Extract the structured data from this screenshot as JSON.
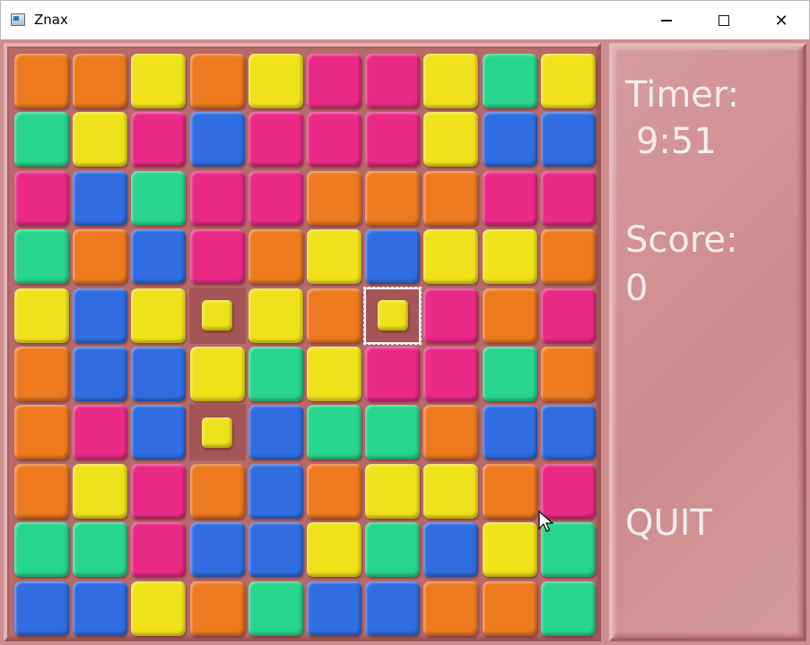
{
  "window": {
    "title": "Znax",
    "icon": "app-window-icon",
    "controls": [
      "minimize-icon",
      "maximize-icon",
      "close-icon"
    ],
    "close_glyph": "✕"
  },
  "colors": {
    "O": "#ee7a20",
    "Y": "#f0e21a",
    "P": "#ea2a86",
    "B": "#2f6de0",
    "G": "#27d58c",
    "frame": "#b86a6a",
    "panel": "#cf8e8e",
    "text": "#fbecec"
  },
  "board": {
    "rows": 10,
    "cols": 10,
    "tiles": [
      [
        "O",
        "O",
        "Y",
        "O",
        "Y",
        "P",
        "P",
        "Y",
        "G",
        "Y"
      ],
      [
        "G",
        "Y",
        "P",
        "B",
        "P",
        "P",
        "P",
        "Y",
        "B",
        "B"
      ],
      [
        "P",
        "B",
        "G",
        "P",
        "P",
        "O",
        "O",
        "O",
        "P",
        "P"
      ],
      [
        "G",
        "O",
        "B",
        "P",
        "O",
        "Y",
        "B",
        "Y",
        "Y",
        "O"
      ],
      [
        "Y",
        "B",
        "Y",
        "y",
        "Y",
        "O",
        "y",
        "P",
        "O",
        "P"
      ],
      [
        "O",
        "B",
        "B",
        "Y",
        "G",
        "Y",
        "P",
        "P",
        "G",
        "O"
      ],
      [
        "O",
        "P",
        "B",
        "y",
        "B",
        "G",
        "G",
        "O",
        "B",
        "B"
      ],
      [
        "O",
        "Y",
        "P",
        "O",
        "B",
        "O",
        "Y",
        "Y",
        "O",
        "P"
      ],
      [
        "G",
        "G",
        "P",
        "B",
        "B",
        "Y",
        "G",
        "B",
        "Y",
        "G"
      ],
      [
        "B",
        "B",
        "Y",
        "O",
        "G",
        "B",
        "B",
        "O",
        "O",
        "G"
      ]
    ],
    "selected": {
      "row": 4,
      "col": 6
    },
    "marked": [
      {
        "row": 4,
        "col": 3
      },
      {
        "row": 6,
        "col": 3
      }
    ]
  },
  "side_panel": {
    "timer_label": "Timer:",
    "timer_value": "9:51",
    "score_label": "Score:",
    "score_value": "0",
    "quit_label": "QUIT"
  }
}
